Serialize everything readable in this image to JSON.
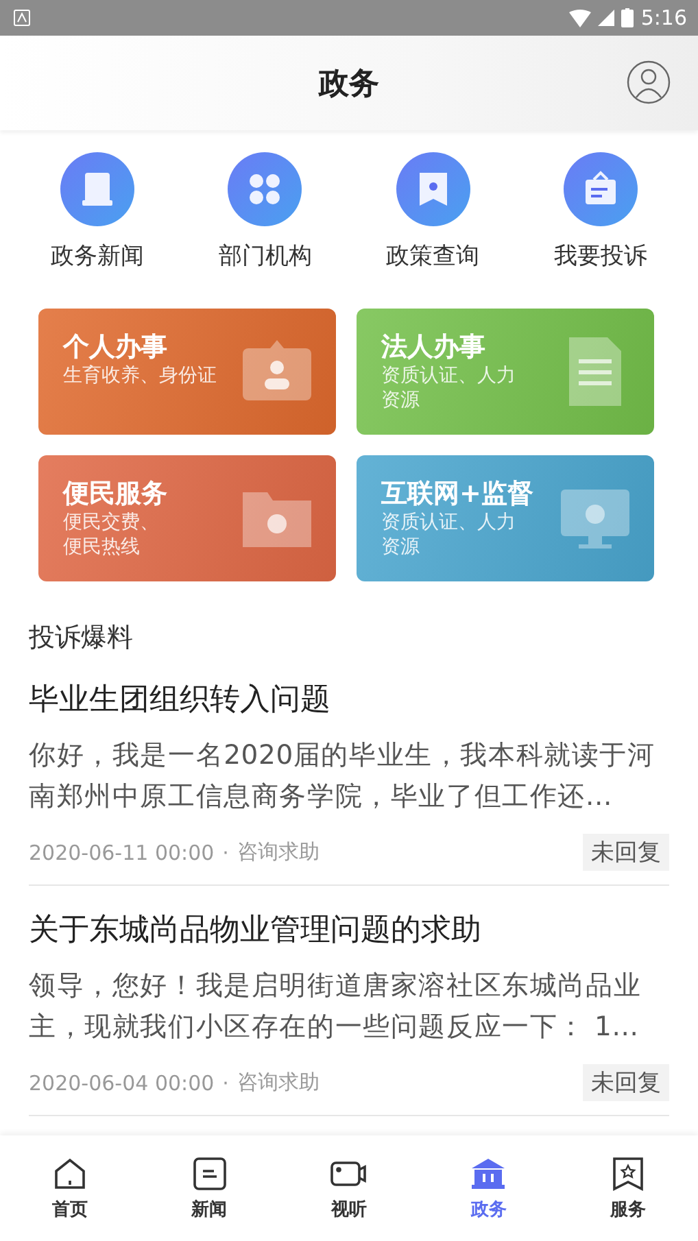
{
  "status_bar": {
    "time": "5:16"
  },
  "header": {
    "title": "政务"
  },
  "quick_links": [
    {
      "label": "政务新闻",
      "kind": "book"
    },
    {
      "label": "部门机构",
      "kind": "grid"
    },
    {
      "label": "政策查询",
      "kind": "banner"
    },
    {
      "label": "我要投诉",
      "kind": "board"
    }
  ],
  "service_cards": [
    {
      "title": "个人办事",
      "subtitle_lines": [
        "生育收养、身份证"
      ],
      "color": "#e06a2e",
      "kind": "person"
    },
    {
      "title": "法人办事",
      "subtitle_lines": [
        "资质认证、人力",
        "资源"
      ],
      "color": "#74c04a",
      "kind": "document"
    },
    {
      "title": "便民服务",
      "subtitle_lines": [
        "便民交费、",
        "便民热线"
      ],
      "color": "#e06845",
      "kind": "folder"
    },
    {
      "title": "互联网+监督",
      "subtitle_lines": [
        "资质认证、人力",
        "资源"
      ],
      "color": "#4aa6cf",
      "kind": "monitor"
    }
  ],
  "section_title": "投诉爆料",
  "posts": [
    {
      "title": "毕业生团组织转入问题",
      "body": " 你好，我是一名2020届的毕业生，我本科就读于河南郑州中原工信息商务学院，毕业了但工作还...",
      "date": "2020-06-11 00:00",
      "separator": "·",
      "category": "咨询求助",
      "status": "未回复"
    },
    {
      "title": "关于东城尚品物业管理问题的求助",
      "body": "领导，您好！我是启明街道唐家溶社区东城尚品业主，现就我们小区存在的一些问题反应一下： 1...",
      "date": "2020-06-04 00:00",
      "separator": "·",
      "category": "咨询求助",
      "status": "未回复"
    }
  ],
  "tab_bar": [
    {
      "label": "首页",
      "kind": "home",
      "selected": false
    },
    {
      "label": "新闻",
      "kind": "news",
      "selected": false
    },
    {
      "label": "视听",
      "kind": "video",
      "selected": false
    },
    {
      "label": "政务",
      "kind": "gov",
      "selected": true
    },
    {
      "label": "服务",
      "kind": "service",
      "selected": false
    }
  ]
}
